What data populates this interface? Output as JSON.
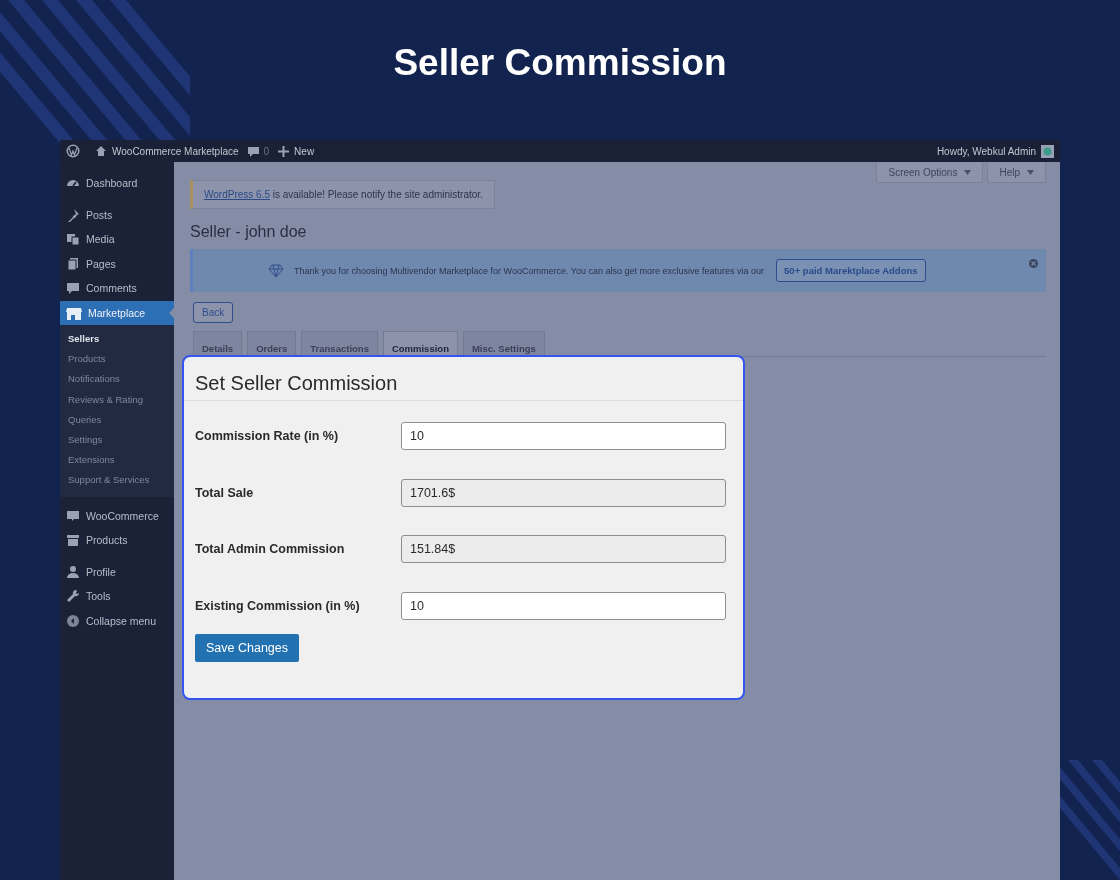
{
  "heading": "Seller Commission",
  "admin_bar": {
    "site": "WooCommerce Marketplace",
    "comments": "0",
    "new": "New",
    "greeting": "Howdy, Webkul Admin"
  },
  "sidebar": {
    "groups": [
      [
        {
          "label": "Dashboard",
          "kind": "gauge",
          "selected": false
        }
      ],
      [
        {
          "label": "Posts",
          "kind": "pin",
          "selected": false
        },
        {
          "label": "Media",
          "kind": "media",
          "selected": false
        },
        {
          "label": "Pages",
          "kind": "pages",
          "selected": false
        },
        {
          "label": "Comments",
          "kind": "bubble",
          "selected": false
        },
        {
          "label": "Marketplace",
          "kind": "store",
          "selected": true,
          "children": [
            {
              "label": "Sellers",
              "selected": true
            },
            {
              "label": "Products",
              "selected": false
            },
            {
              "label": "Notifications",
              "selected": false
            },
            {
              "label": "Reviews & Rating",
              "selected": false
            },
            {
              "label": "Queries",
              "selected": false
            },
            {
              "label": "Settings",
              "selected": false
            },
            {
              "label": "Extensions",
              "selected": false
            },
            {
              "label": "Support & Services",
              "selected": false
            }
          ]
        }
      ],
      [
        {
          "label": "WooCommerce",
          "kind": "woo",
          "selected": false
        },
        {
          "label": "Products",
          "kind": "archive",
          "selected": false
        }
      ],
      [
        {
          "label": "Profile",
          "kind": "person",
          "selected": false
        },
        {
          "label": "Tools",
          "kind": "wrench",
          "selected": false
        },
        {
          "label": "Collapse menu",
          "kind": "collapse",
          "selected": false
        }
      ]
    ]
  },
  "screen_buttons": [
    "Screen Options",
    "Help"
  ],
  "notice": {
    "link": "WordPress 6.5",
    "text": " is available! Please notify the site administrator."
  },
  "page_title": "Seller - john doe",
  "banner": {
    "text": "Thank you for choosing Multivendor Marketplace for WooCommerce. You can also get more exclusive features via our",
    "button": "50+ paid Marektplace Addons"
  },
  "back_button": "Back",
  "tabs": [
    {
      "label": "Details",
      "selected": false
    },
    {
      "label": "Orders",
      "selected": false
    },
    {
      "label": "Transactions",
      "selected": false
    },
    {
      "label": "Commission",
      "selected": true
    },
    {
      "label": "Misc. Settings",
      "selected": false
    }
  ],
  "dialog": {
    "title": "Set Seller Commission",
    "fields": [
      {
        "label": "Commission Rate (in %)",
        "value": "10",
        "disabled": false
      },
      {
        "label": "Total Sale",
        "value": "1701.6$",
        "disabled": true
      },
      {
        "label": "Total Admin Commission",
        "value": "151.84$",
        "disabled": true
      },
      {
        "label": "Existing Commission (in %)",
        "value": "10",
        "disabled": false
      }
    ],
    "save_button": "Save Changes"
  }
}
